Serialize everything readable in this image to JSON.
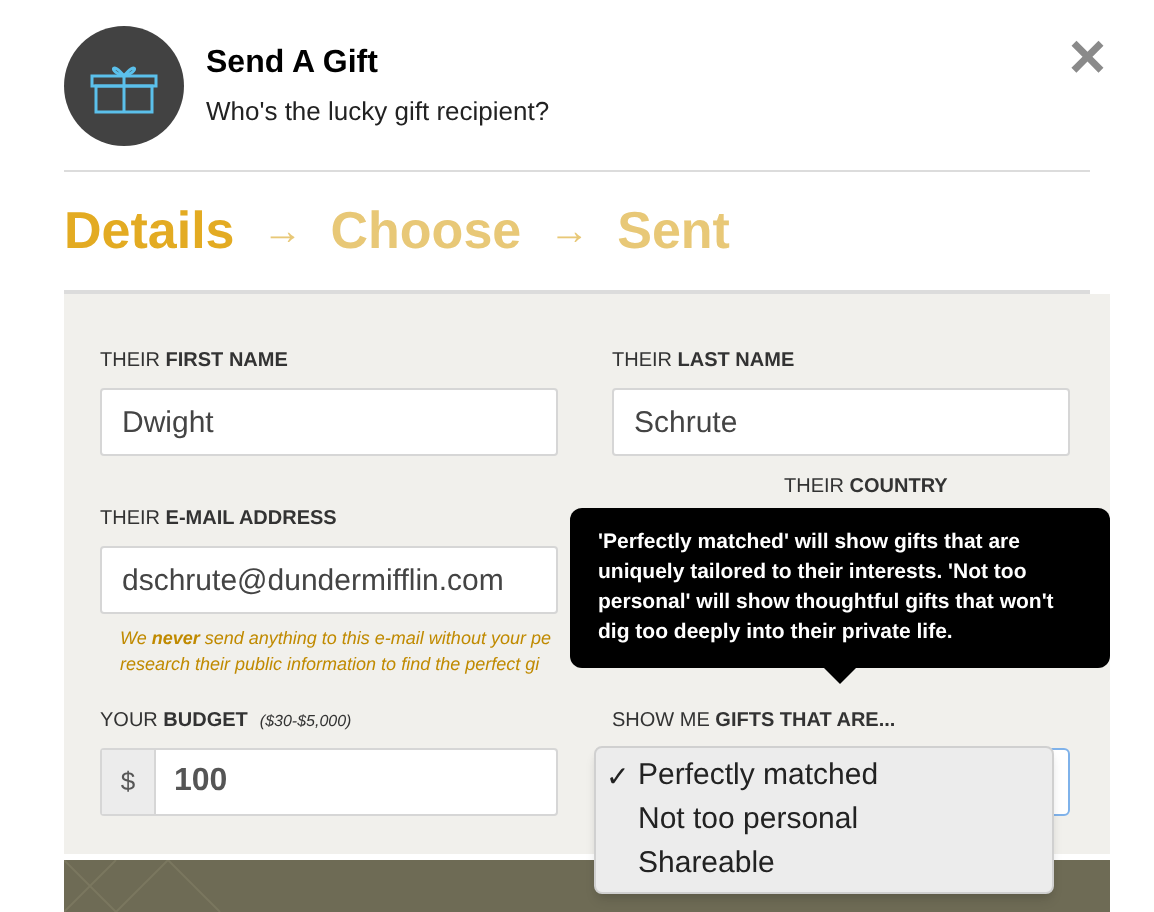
{
  "header": {
    "title": "Send A Gift",
    "subtitle": "Who's the lucky gift recipient?",
    "close": "×"
  },
  "steps": [
    {
      "label": "Details",
      "selected": true
    },
    {
      "label": "Choose",
      "selected": false
    },
    {
      "label": "Sent",
      "selected": false
    }
  ],
  "step_arrow": "→",
  "form": {
    "first_name": {
      "label": "THEIR **FIRST NAME**",
      "value": "Dwight"
    },
    "last_name": {
      "label": "THEIR **LAST NAME**",
      "value": "Schrute"
    },
    "email": {
      "label": "THEIR **E-MAIL ADDRESS**",
      "value": "dschrute@dundermifflin.com"
    },
    "country": {
      "label": "THEIR **COUNTRY**"
    },
    "notice_lines": [
      "We **never** send anything to this e-mail without your pe",
      "research their public information to find the perfect gi"
    ],
    "budget": {
      "label": "YOUR **BUDGET**",
      "range": "($30-$5,000)",
      "prefix": "$",
      "value": "100"
    },
    "gift_type": {
      "label": "SHOW ME **GIFTS THAT ARE...**",
      "options": [
        {
          "label": "Perfectly matched",
          "selected": true
        },
        {
          "label": "Not too personal",
          "selected": false
        },
        {
          "label": "Shareable",
          "selected": false
        }
      ],
      "check": "✓"
    }
  },
  "tooltip": "'Perfectly matched' will show gifts that are uniquely tailored to their interests. 'Not too personal' will show thoughtful gifts that won't dig too deeply into their private life."
}
